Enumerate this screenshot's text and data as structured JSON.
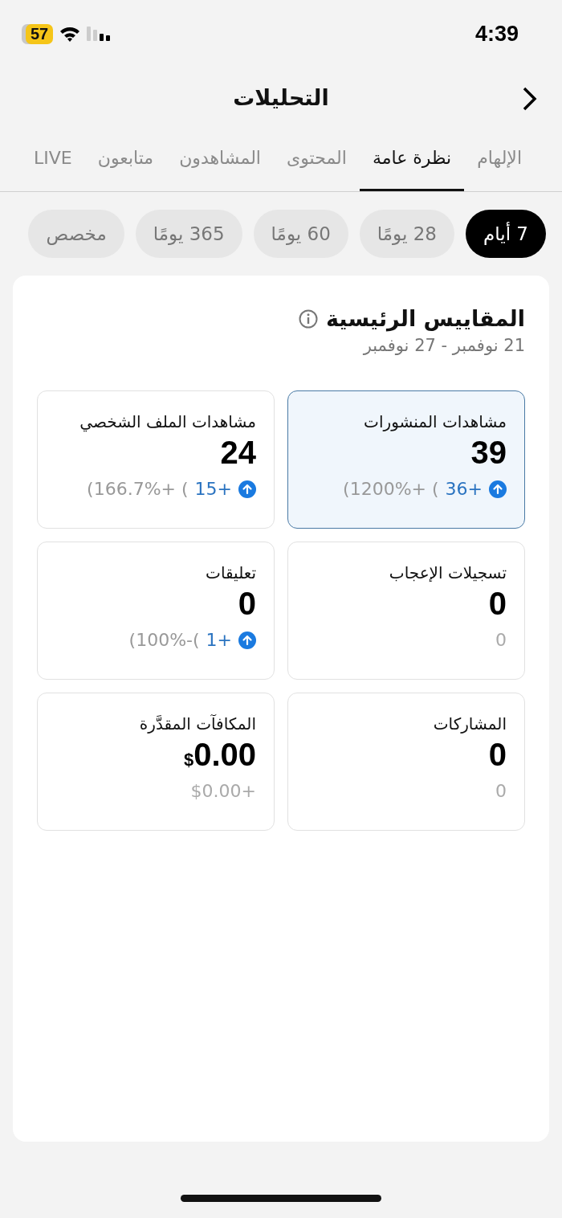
{
  "status_bar": {
    "time": "4:39",
    "battery": "57"
  },
  "header": {
    "title": "التحليلات"
  },
  "tabs": [
    {
      "label": "الإلهام",
      "selected": false
    },
    {
      "label": "نظرة عامة",
      "selected": true
    },
    {
      "label": "المحتوى",
      "selected": false
    },
    {
      "label": "المشاهدون",
      "selected": false
    },
    {
      "label": "متابعون",
      "selected": false
    },
    {
      "label": "LIVE",
      "selected": false
    }
  ],
  "ranges": [
    {
      "label": "7 أيام",
      "selected": true
    },
    {
      "label": "28 يومًا",
      "selected": false
    },
    {
      "label": "60 يومًا",
      "selected": false
    },
    {
      "label": "365 يومًا",
      "selected": false
    },
    {
      "label": "مخصص",
      "selected": false
    }
  ],
  "metrics": {
    "title": "المقاييس الرئيسية",
    "date_range": "21 نوفمبر - 27 نوفمبر",
    "cards": [
      {
        "kind": "trend",
        "title": "مشاهدات المنشورات",
        "value": "39",
        "delta": "36+",
        "pct": "(1200%+ (",
        "selected": true
      },
      {
        "kind": "trend",
        "title": "مشاهدات الملف الشخصي",
        "value": "24",
        "delta": "15+",
        "pct": "(166.7%+ (",
        "selected": false
      },
      {
        "kind": "plain",
        "title": "تسجيلات الإعجاب",
        "value": "0",
        "change": "0",
        "selected": false
      },
      {
        "kind": "trend",
        "title": "تعليقات",
        "value": "0",
        "delta": "1+",
        "pct": "(100%-(",
        "selected": false
      },
      {
        "kind": "plain",
        "title": "المشاركات",
        "value": "0",
        "change": "0",
        "selected": false
      },
      {
        "kind": "money",
        "title": "المكافآت المقدَّرة",
        "value": "0.00",
        "currency": "$",
        "change": "$0.00+",
        "selected": false
      }
    ]
  }
}
